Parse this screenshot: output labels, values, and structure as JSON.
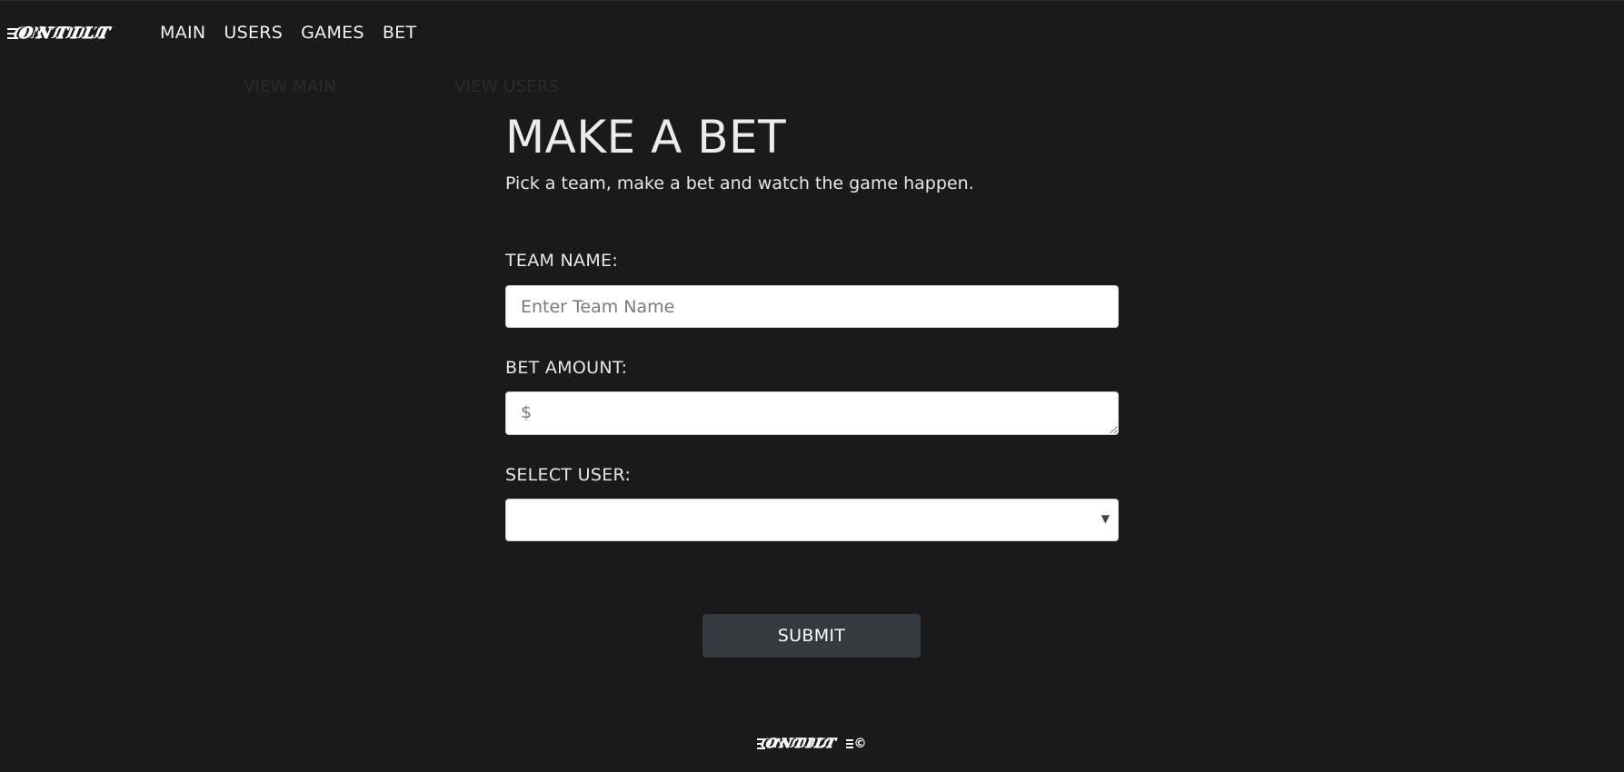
{
  "brand": {
    "logo_text": "ONTILT",
    "copyright_symbol": "©"
  },
  "nav": {
    "items": [
      "MAIN",
      "USERS",
      "GAMES",
      "BET"
    ]
  },
  "subnav": {
    "view_main": "VIEW MAIN",
    "view_users": "VIEW USERS"
  },
  "page": {
    "title": "MAKE A BET",
    "subtitle": "Pick a team, make a bet and watch the game happen."
  },
  "form": {
    "team_label": "TEAM NAME:",
    "team_placeholder": "Enter Team Name",
    "team_value": "",
    "amount_label": "BET AMOUNT:",
    "amount_placeholder": "$",
    "amount_value": "",
    "user_label": "SELECT USER:",
    "user_selected": "",
    "submit_label": "SUBMIT"
  },
  "icons": {
    "select_caret": "chevron-down-icon"
  },
  "colors": {
    "background": "#1a1a1a",
    "button": "#343a40",
    "field": "#ffffff"
  }
}
